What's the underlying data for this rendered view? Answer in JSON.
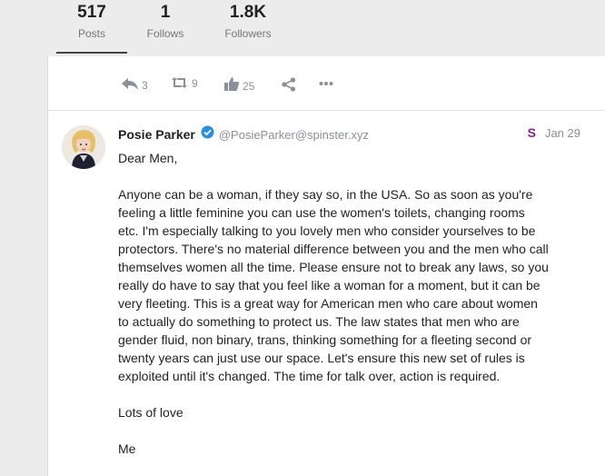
{
  "stats": {
    "posts": {
      "value": "517",
      "label": "Posts"
    },
    "follows": {
      "value": "1",
      "label": "Follows"
    },
    "followers": {
      "value": "1.8K",
      "label": "Followers"
    }
  },
  "actions": {
    "reply_count": "3",
    "boost_count": "9",
    "favourite_count": "25"
  },
  "post": {
    "author_name": "Posie Parker",
    "author_handle": "@PosieParker@spinster.xyz",
    "instance_icon": "S",
    "date": "Jan 29",
    "paragraphs": [
      "Dear Men,",
      "Anyone can be a woman, if they say so, in the USA. So as soon as you're\nfeeling a little feminine you can use the women's toilets, changing rooms\netc. I'm especially talking to you lovely men who consider yourselves to be\nprotectors. There's no material difference between you and the men who call\nthemselves women all the time. Please ensure not to break any laws, so you\nreally do have to say that you feel like a woman for a moment, but it can be\nvery fleeting. This is a great way for American men who care about women\nto actually do something to protect us. The law states that men who are\ngender fluid, non binary, trans, thinking something for a fleeting second or\ntwenty years can just use our space. Let's ensure this new set of rules is\nexploited until it's changed. The time for talk over, action is required.",
      "Lots of love",
      "Me"
    ]
  },
  "colors": {
    "accent_verified": "#2b90d9",
    "instance_icon": "#8c1b8f",
    "muted": "#8a8f98"
  }
}
